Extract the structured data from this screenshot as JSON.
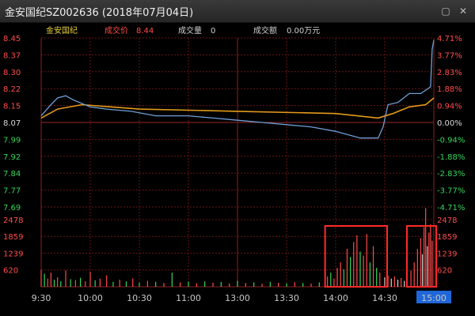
{
  "window": {
    "title": "金安国纪SZ002636 (2018年07月04日)",
    "close_glyph": "✕",
    "restore_glyph": "▢"
  },
  "info": {
    "name": "金安国纪",
    "price_label": "成交价",
    "price_value": "8.44",
    "volume_label": "成交量",
    "volume_value": "0",
    "amount_label": "成交额",
    "amount_value": "0.00万元"
  },
  "colors": {
    "up": "#ff4b4b",
    "down": "#34d55a",
    "flat": "#d8d8d8",
    "price_line": "#6f9fd6",
    "avg_line": "#e39b19",
    "highlight_box": "#ff2a2a",
    "time_badge": "#1f66d8",
    "grid": "#6b1414"
  },
  "chart_data": {
    "type": "line",
    "prev_close": 8.07,
    "y_ticks": [
      "8.45",
      "8.37",
      "8.30",
      "8.22",
      "8.15",
      "8.07",
      "7.99",
      "7.92",
      "7.84",
      "7.77",
      "7.69"
    ],
    "pct_ticks": [
      "4.71%",
      "3.77%",
      "2.83%",
      "1.88%",
      "0.94%",
      "0.00%",
      "-0.94%",
      "-1.88%",
      "-2.83%",
      "-3.77%",
      "-4.71%"
    ],
    "ylim": [
      7.69,
      8.45
    ],
    "volume_ticks": [
      "2478",
      "1859",
      "1239",
      "620"
    ],
    "volume_max": 2478,
    "x_labels": [
      "9:30",
      "10:00",
      "10:30",
      "11:00",
      "13:00",
      "13:30",
      "14:00",
      "14:30",
      "15:00"
    ],
    "highlight_x_label": "15:00",
    "price": [
      [
        0,
        8.1
      ],
      [
        6,
        8.15
      ],
      [
        10,
        8.18
      ],
      [
        15,
        8.19
      ],
      [
        20,
        8.17
      ],
      [
        30,
        8.14
      ],
      [
        40,
        8.13
      ],
      [
        55,
        8.12
      ],
      [
        70,
        8.1
      ],
      [
        90,
        8.1
      ],
      [
        105,
        8.09
      ],
      [
        120,
        8.08
      ],
      [
        135,
        8.07
      ],
      [
        150,
        8.06
      ],
      [
        165,
        8.05
      ],
      [
        180,
        8.03
      ],
      [
        195,
        8.0
      ],
      [
        206,
        8.0
      ],
      [
        209,
        8.05
      ],
      [
        212,
        8.15
      ],
      [
        218,
        8.16
      ],
      [
        225,
        8.2
      ],
      [
        232,
        8.2
      ],
      [
        238,
        8.23
      ],
      [
        239,
        8.4
      ],
      [
        240,
        8.44
      ]
    ],
    "avg_price": [
      [
        0,
        8.09
      ],
      [
        10,
        8.13
      ],
      [
        25,
        8.15
      ],
      [
        60,
        8.13
      ],
      [
        120,
        8.12
      ],
      [
        180,
        8.11
      ],
      [
        206,
        8.09
      ],
      [
        215,
        8.11
      ],
      [
        225,
        8.14
      ],
      [
        235,
        8.15
      ],
      [
        240,
        8.18
      ]
    ],
    "volume_annotation_boxes": [
      [
        175,
        210
      ],
      [
        225,
        240
      ]
    ],
    "volume": [
      {
        "t": 0,
        "v": 620,
        "dir": "up"
      },
      {
        "t": 2,
        "v": 480,
        "dir": "down"
      },
      {
        "t": 4,
        "v": 300,
        "dir": "up"
      },
      {
        "t": 6,
        "v": 520,
        "dir": "up"
      },
      {
        "t": 8,
        "v": 260,
        "dir": "down"
      },
      {
        "t": 10,
        "v": 350,
        "dir": "up"
      },
      {
        "t": 12,
        "v": 210,
        "dir": "down"
      },
      {
        "t": 15,
        "v": 600,
        "dir": "up"
      },
      {
        "t": 18,
        "v": 280,
        "dir": "down"
      },
      {
        "t": 21,
        "v": 250,
        "dir": "up"
      },
      {
        "t": 24,
        "v": 330,
        "dir": "down"
      },
      {
        "t": 27,
        "v": 200,
        "dir": "up"
      },
      {
        "t": 30,
        "v": 560,
        "dir": "up"
      },
      {
        "t": 33,
        "v": 240,
        "dir": "down"
      },
      {
        "t": 36,
        "v": 300,
        "dir": "up"
      },
      {
        "t": 40,
        "v": 420,
        "dir": "up"
      },
      {
        "t": 44,
        "v": 180,
        "dir": "down"
      },
      {
        "t": 48,
        "v": 260,
        "dir": "up"
      },
      {
        "t": 52,
        "v": 200,
        "dir": "down"
      },
      {
        "t": 56,
        "v": 310,
        "dir": "up"
      },
      {
        "t": 60,
        "v": 150,
        "dir": "down"
      },
      {
        "t": 65,
        "v": 220,
        "dir": "up"
      },
      {
        "t": 70,
        "v": 180,
        "dir": "down"
      },
      {
        "t": 75,
        "v": 140,
        "dir": "up"
      },
      {
        "t": 80,
        "v": 520,
        "dir": "down"
      },
      {
        "t": 85,
        "v": 160,
        "dir": "up"
      },
      {
        "t": 90,
        "v": 190,
        "dir": "down"
      },
      {
        "t": 95,
        "v": 130,
        "dir": "up"
      },
      {
        "t": 100,
        "v": 200,
        "dir": "down"
      },
      {
        "t": 105,
        "v": 150,
        "dir": "up"
      },
      {
        "t": 110,
        "v": 180,
        "dir": "down"
      },
      {
        "t": 115,
        "v": 120,
        "dir": "up"
      },
      {
        "t": 120,
        "v": 220,
        "dir": "down"
      },
      {
        "t": 125,
        "v": 140,
        "dir": "up"
      },
      {
        "t": 130,
        "v": 160,
        "dir": "down"
      },
      {
        "t": 135,
        "v": 110,
        "dir": "up"
      },
      {
        "t": 140,
        "v": 180,
        "dir": "down"
      },
      {
        "t": 145,
        "v": 150,
        "dir": "up"
      },
      {
        "t": 150,
        "v": 130,
        "dir": "down"
      },
      {
        "t": 155,
        "v": 170,
        "dir": "up"
      },
      {
        "t": 160,
        "v": 140,
        "dir": "down"
      },
      {
        "t": 165,
        "v": 120,
        "dir": "up"
      },
      {
        "t": 170,
        "v": 160,
        "dir": "down"
      },
      {
        "t": 175,
        "v": 380,
        "dir": "up"
      },
      {
        "t": 177,
        "v": 520,
        "dir": "down"
      },
      {
        "t": 179,
        "v": 300,
        "dir": "up"
      },
      {
        "t": 181,
        "v": 700,
        "dir": "up"
      },
      {
        "t": 183,
        "v": 900,
        "dir": "up"
      },
      {
        "t": 185,
        "v": 640,
        "dir": "down"
      },
      {
        "t": 187,
        "v": 1400,
        "dir": "up"
      },
      {
        "t": 189,
        "v": 1100,
        "dir": "down"
      },
      {
        "t": 191,
        "v": 1650,
        "dir": "up"
      },
      {
        "t": 193,
        "v": 1900,
        "dir": "up"
      },
      {
        "t": 195,
        "v": 1300,
        "dir": "down"
      },
      {
        "t": 197,
        "v": 1150,
        "dir": "up"
      },
      {
        "t": 199,
        "v": 1950,
        "dir": "up"
      },
      {
        "t": 201,
        "v": 900,
        "dir": "down"
      },
      {
        "t": 203,
        "v": 1500,
        "dir": "up"
      },
      {
        "t": 205,
        "v": 700,
        "dir": "down"
      },
      {
        "t": 207,
        "v": 520,
        "dir": "up"
      },
      {
        "t": 210,
        "v": 350,
        "dir": "flat"
      },
      {
        "t": 212,
        "v": 420,
        "dir": "up"
      },
      {
        "t": 214,
        "v": 300,
        "dir": "flat"
      },
      {
        "t": 216,
        "v": 380,
        "dir": "up"
      },
      {
        "t": 218,
        "v": 260,
        "dir": "flat"
      },
      {
        "t": 220,
        "v": 320,
        "dir": "up"
      },
      {
        "t": 222,
        "v": 220,
        "dir": "flat"
      },
      {
        "t": 226,
        "v": 600,
        "dir": "up"
      },
      {
        "t": 228,
        "v": 900,
        "dir": "up"
      },
      {
        "t": 230,
        "v": 1400,
        "dir": "up"
      },
      {
        "t": 232,
        "v": 1800,
        "dir": "up"
      },
      {
        "t": 233,
        "v": 1200,
        "dir": "flat"
      },
      {
        "t": 234,
        "v": 2200,
        "dir": "up"
      },
      {
        "t": 235,
        "v": 2900,
        "dir": "up"
      },
      {
        "t": 236,
        "v": 1500,
        "dir": "flat"
      },
      {
        "t": 237,
        "v": 2000,
        "dir": "up"
      },
      {
        "t": 238,
        "v": 2300,
        "dir": "up"
      },
      {
        "t": 239,
        "v": 1700,
        "dir": "up"
      }
    ]
  }
}
